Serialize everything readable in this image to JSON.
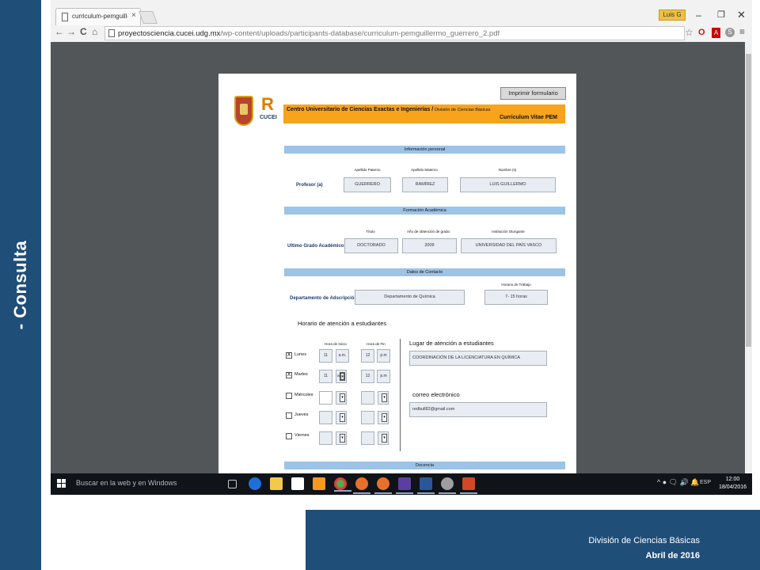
{
  "slide": {
    "side_title": "- Consulta",
    "footer_line1": "División de Ciencias Básicas",
    "footer_line2": "Abril de 2016"
  },
  "browser": {
    "tab_title": "curriculum-pemguillerm",
    "tab_close": "×",
    "user_badge": "Luis G",
    "win_min": "–",
    "win_max": "❐",
    "win_close": "✕",
    "nav_back": "←",
    "nav_forward": "→",
    "nav_reload": "C",
    "nav_home": "⌂",
    "url_host": "proyectosciencia.cucei.udg.mx",
    "url_path": "/wp-content/uploads/participants-database/curriculum-pemguillermo_guerrero_2.pdf",
    "star_icon": "☆",
    "menu_icon": "≡"
  },
  "pdf": {
    "print_button": "Imprimir formulario",
    "center_name": "Centro Universitario de Ciencias Exactas e Ingenierías /",
    "division": "División de Ciencias Básicas",
    "doc_title": "Curriculum Vitae PEM",
    "logo_text": "CUCEI",
    "personal": {
      "section": "Información personal",
      "label_paterno": "Apellido Paterno",
      "label_materno": "Apellido Materno",
      "label_nombre": "Nombre (s)",
      "row_label": "Profesor (a)",
      "paterno": "GUERRERO",
      "materno": "RAMÍREZ",
      "nombre": "LUIS GUILLERMO"
    },
    "academic": {
      "section": "Formación Académica",
      "label_titulo": "Título",
      "label_anio": "Año de obtención de grado",
      "label_institucion": "Institución Otorgante",
      "row_label": "Ultimo Grado Académico",
      "titulo": "DOCTORADO",
      "anio": "2009",
      "institucion": "UNIVERSIDAD DEL PAÍS VASCO"
    },
    "contact": {
      "section": "Datos de Contacto",
      "label_horario": "Horario de Trabajo",
      "row_label": "Departamento de Adscripción",
      "departamento": "Departamento de Química",
      "horario": "7- 15 horas"
    },
    "attention": {
      "heading": "Horario de atención a estudiantes",
      "label_inicio": "Hora de Inicio",
      "label_fin": "Hora de Fin",
      "days": [
        {
          "name": "Lunes",
          "checked": "X",
          "start": "11",
          "start_ampm": "a.m.",
          "end": "12",
          "end_ampm": "p.m"
        },
        {
          "name": "Martes",
          "checked": "X",
          "start": "11",
          "start_ampm": "a.",
          "end": "12",
          "end_ampm": "p.m"
        },
        {
          "name": "Miércoles",
          "checked": "",
          "start": "",
          "start_ampm": "",
          "end": "",
          "end_ampm": ""
        },
        {
          "name": "Jueves",
          "checked": "",
          "start": "",
          "start_ampm": "",
          "end": "",
          "end_ampm": ""
        },
        {
          "name": "Viernes",
          "checked": "",
          "start": "",
          "start_ampm": "",
          "end": "",
          "end_ampm": ""
        }
      ],
      "lugar_heading": "Lugar de atención a estudiantes",
      "lugar": "COORDINACIÓN DE LA LICENCIATURA EN QUÍMICA",
      "email_heading": "correo electrónico",
      "email": "redbull82@gmail.com"
    },
    "docencia": {
      "section": "Docencia"
    }
  },
  "taskbar": {
    "search_placeholder": "Buscar en la web y en Windows",
    "language": "ESP",
    "time": "12:00",
    "date": "18/04/2016",
    "tray_symbols": "^ ● 🗨 🔊 🔔"
  },
  "colors": {
    "slide_blue": "#1f4e79",
    "header_orange": "#f7a31b",
    "section_blue": "#9dc3e6",
    "field_bg": "#e8edf4"
  }
}
